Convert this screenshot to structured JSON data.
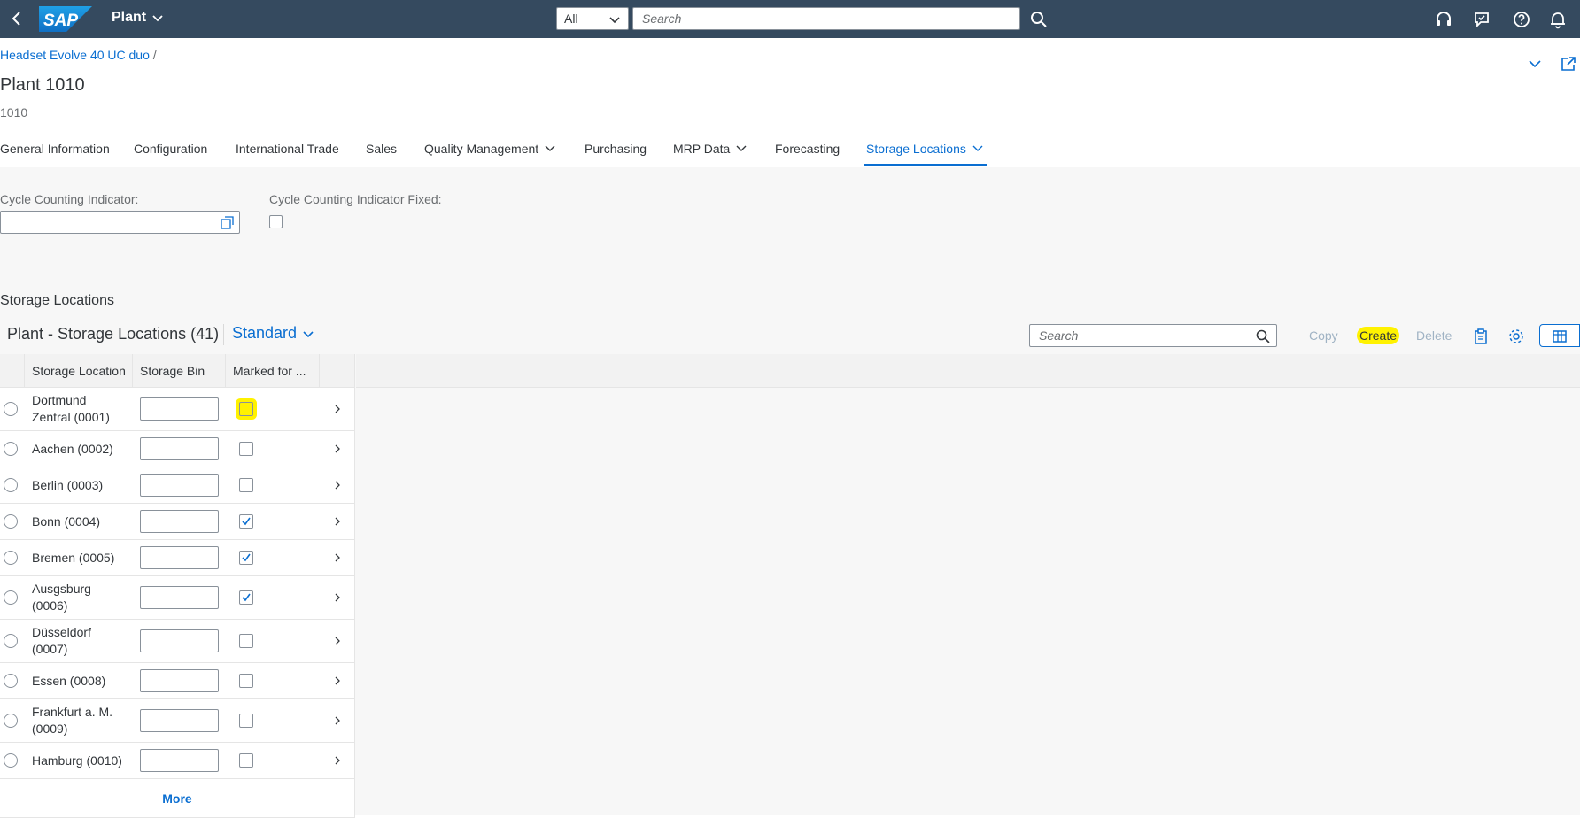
{
  "shell": {
    "app_title": "Plant",
    "scope": "All",
    "search_placeholder": "Search",
    "logo_text": "SAP"
  },
  "header": {
    "breadcrumb_link": "Headset Evolve 40 UC duo",
    "breadcrumb_sep": "/",
    "title": "Plant 1010",
    "subtitle": "1010"
  },
  "tabs": [
    {
      "label": "General Information"
    },
    {
      "label": "Configuration"
    },
    {
      "label": "International Trade"
    },
    {
      "label": "Sales"
    },
    {
      "label": "Quality Management"
    },
    {
      "label": "Purchasing"
    },
    {
      "label": "MRP Data"
    },
    {
      "label": "Forecasting"
    },
    {
      "label": "Storage Locations"
    }
  ],
  "fields": {
    "cycle_counting_label": "Cycle Counting Indicator:",
    "cycle_counting_value": "",
    "cycle_counting_fixed_label": "Cycle Counting Indicator Fixed:"
  },
  "section": {
    "heading": "Storage Locations"
  },
  "table_toolbar": {
    "title": "Plant - Storage Locations (41)",
    "variant": "Standard",
    "search_placeholder": "Search",
    "copy_label": "Copy",
    "create_label": "Create",
    "delete_label": "Delete"
  },
  "table": {
    "columns": [
      "Storage Location",
      "Storage Bin",
      "Marked for ..."
    ],
    "rows": [
      {
        "name": "Dortmund Zentral (0001)",
        "bin": "",
        "marked": false
      },
      {
        "name": "Aachen (0002)",
        "bin": "",
        "marked": false
      },
      {
        "name": "Berlin (0003)",
        "bin": "",
        "marked": false
      },
      {
        "name": "Bonn (0004)",
        "bin": "",
        "marked": true
      },
      {
        "name": "Bremen (0005)",
        "bin": "",
        "marked": true
      },
      {
        "name": "Ausgsburg (0006)",
        "bin": "",
        "marked": true
      },
      {
        "name": "Düsseldorf (0007)",
        "bin": "",
        "marked": false
      },
      {
        "name": "Essen (0008)",
        "bin": "",
        "marked": false
      },
      {
        "name": "Frankfurt a. M. (0009)",
        "bin": "",
        "marked": false
      },
      {
        "name": "Hamburg (0010)",
        "bin": "",
        "marked": false
      }
    ],
    "more_label": "More"
  },
  "colors": {
    "shell_bg": "#354a5f",
    "accent": "#0a6ed1",
    "highlight": "#fff200"
  },
  "icons": [
    "back-icon",
    "chevron-down-icon",
    "search-icon",
    "headset-icon",
    "feedback-icon",
    "help-icon",
    "bell-icon",
    "share-icon",
    "value-help-icon",
    "clipboard-icon",
    "gear-icon",
    "table-settings-icon",
    "chevron-right-icon",
    "checkmark-icon"
  ]
}
